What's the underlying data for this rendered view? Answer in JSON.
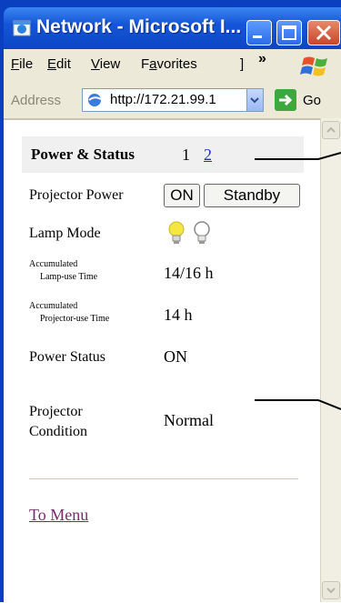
{
  "window": {
    "title": "Network - Microsoft I...",
    "app_icon": "ie-icon",
    "controls": [
      "minimize-icon",
      "maximize-icon",
      "close-icon"
    ]
  },
  "menu": {
    "items": [
      {
        "label": "File",
        "accel": "F",
        "rest": "ile"
      },
      {
        "label": "Edit",
        "accel": "E",
        "rest": "dit"
      },
      {
        "label": "View",
        "accel": "V",
        "rest": "iew"
      },
      {
        "label": "Favorites",
        "accel": "a",
        "pre": "F",
        "rest": "vorites"
      },
      {
        "label": "]"
      }
    ],
    "overflow": "»"
  },
  "address": {
    "label": "Address",
    "value": "http://172.21.99.1",
    "go_label": "Go"
  },
  "page": {
    "header_label": "Power & Status",
    "page_current": "1",
    "page_link": "2",
    "projector_power_label": "Projector Power",
    "on_button": "ON",
    "standby_button": "Standby",
    "lamp_mode_label": "Lamp Mode",
    "lamp_use_label_1": "Accumulated",
    "lamp_use_label_2": "Lamp-use  Time",
    "lamp_use_value": "14/16 h",
    "projector_use_label_1": "Accumulated",
    "projector_use_label_2": "Projector-use  Time",
    "projector_use_value": "14 h",
    "power_status_label": "Power Status",
    "power_status_value": "ON",
    "condition_label_1": "Projector",
    "condition_label_2": "Condition",
    "condition_value": "Normal",
    "to_menu": "To Menu"
  },
  "colors": {
    "titlebar": "#1556d8",
    "link": "#1a2ec8",
    "visited_link": "#7a2a6a",
    "bulb_on": "#f5e642"
  }
}
